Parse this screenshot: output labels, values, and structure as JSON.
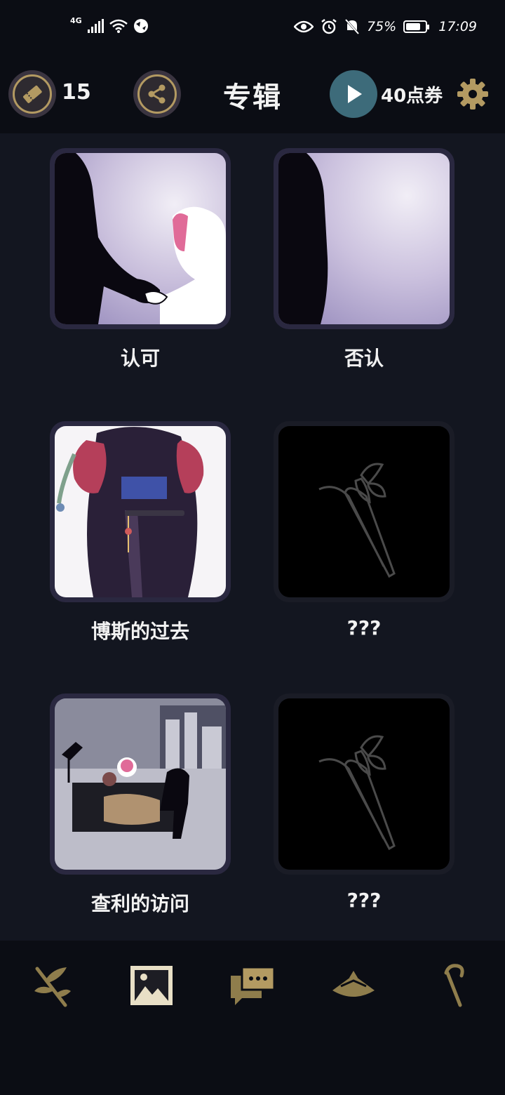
{
  "status_bar": {
    "network": "4G",
    "battery": "75%",
    "battery_level": 0.75,
    "time": "17:09"
  },
  "header": {
    "ticket_count": "15",
    "title": "专辑",
    "coupons": "40点券",
    "accent_color": "#b39a62",
    "play_color": "#3d6b7a"
  },
  "albums": [
    {
      "label": "认可",
      "locked": false
    },
    {
      "label": "否认",
      "locked": false
    },
    {
      "label": "博斯的过去",
      "locked": false
    },
    {
      "label": "???",
      "locked": true
    },
    {
      "label": "查利的访问",
      "locked": false
    },
    {
      "label": "???",
      "locked": true
    }
  ],
  "bottom_nav": [
    {
      "icon": "branch-icon"
    },
    {
      "icon": "gallery-icon",
      "active": true
    },
    {
      "icon": "chat-icon"
    },
    {
      "icon": "hat-icon"
    },
    {
      "icon": "cane-icon"
    }
  ]
}
